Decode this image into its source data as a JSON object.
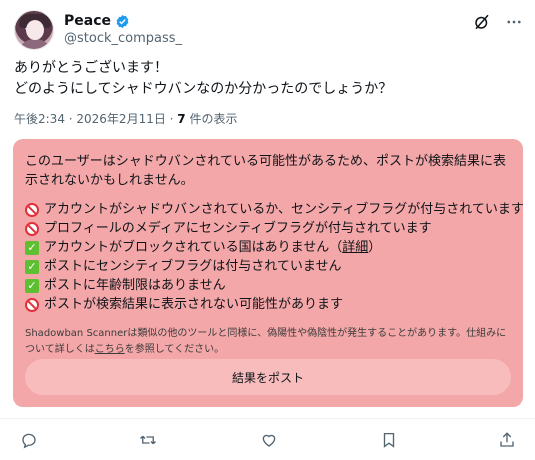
{
  "user": {
    "display_name": "Peace",
    "handle": "@stock_compass_"
  },
  "tweet": {
    "lines": [
      "ありがとうございます！",
      "どのようにしてシャドウバンなのか分かったのでしょうか？"
    ],
    "time": "午後2:34 · 2026年2月11日 · ",
    "views_count": "7",
    "views_label": " 件の表示"
  },
  "shadowban_panel": {
    "intro": "このユーザーはシャドウバンされている可能性があるため、ポストが検索結果に表示されないかもしれません。",
    "checks": [
      {
        "status": "ng",
        "text": "アカウントがシャドウバンされているか、センシティブフラグが付与されています"
      },
      {
        "status": "ng",
        "text": "プロフィールのメディアにセンシティブフラグが付与されています"
      },
      {
        "status": "ok",
        "text": "アカウントがブロックされている国はありません（",
        "link": "詳細",
        "suffix": "）"
      },
      {
        "status": "ok",
        "text": "ポストにセンシティブフラグは付与されていません"
      },
      {
        "status": "ok",
        "text": "ポストに年齢制限はありません"
      },
      {
        "status": "ng",
        "text": "ポストが検索結果に表示されない可能性があります"
      }
    ],
    "disclaimer_pre": "Shadowban Scannerは類似の他のツールと同様に、偽陽性や偽陰性が発生することがあります。仕組みについて詳しくは",
    "disclaimer_link": "こちら",
    "disclaimer_post": "を参照してください。",
    "post_button": "結果をポスト"
  },
  "colors": {
    "panel_bg": "#f4a7a8",
    "ng": "#e0303a",
    "ok": "#5fbf32",
    "verified": "#1d9bf0"
  },
  "icons": {
    "header": [
      "grok-icon",
      "more-icon"
    ],
    "actions": [
      "reply-icon",
      "repost-icon",
      "like-icon",
      "bookmark-icon",
      "share-icon"
    ]
  }
}
